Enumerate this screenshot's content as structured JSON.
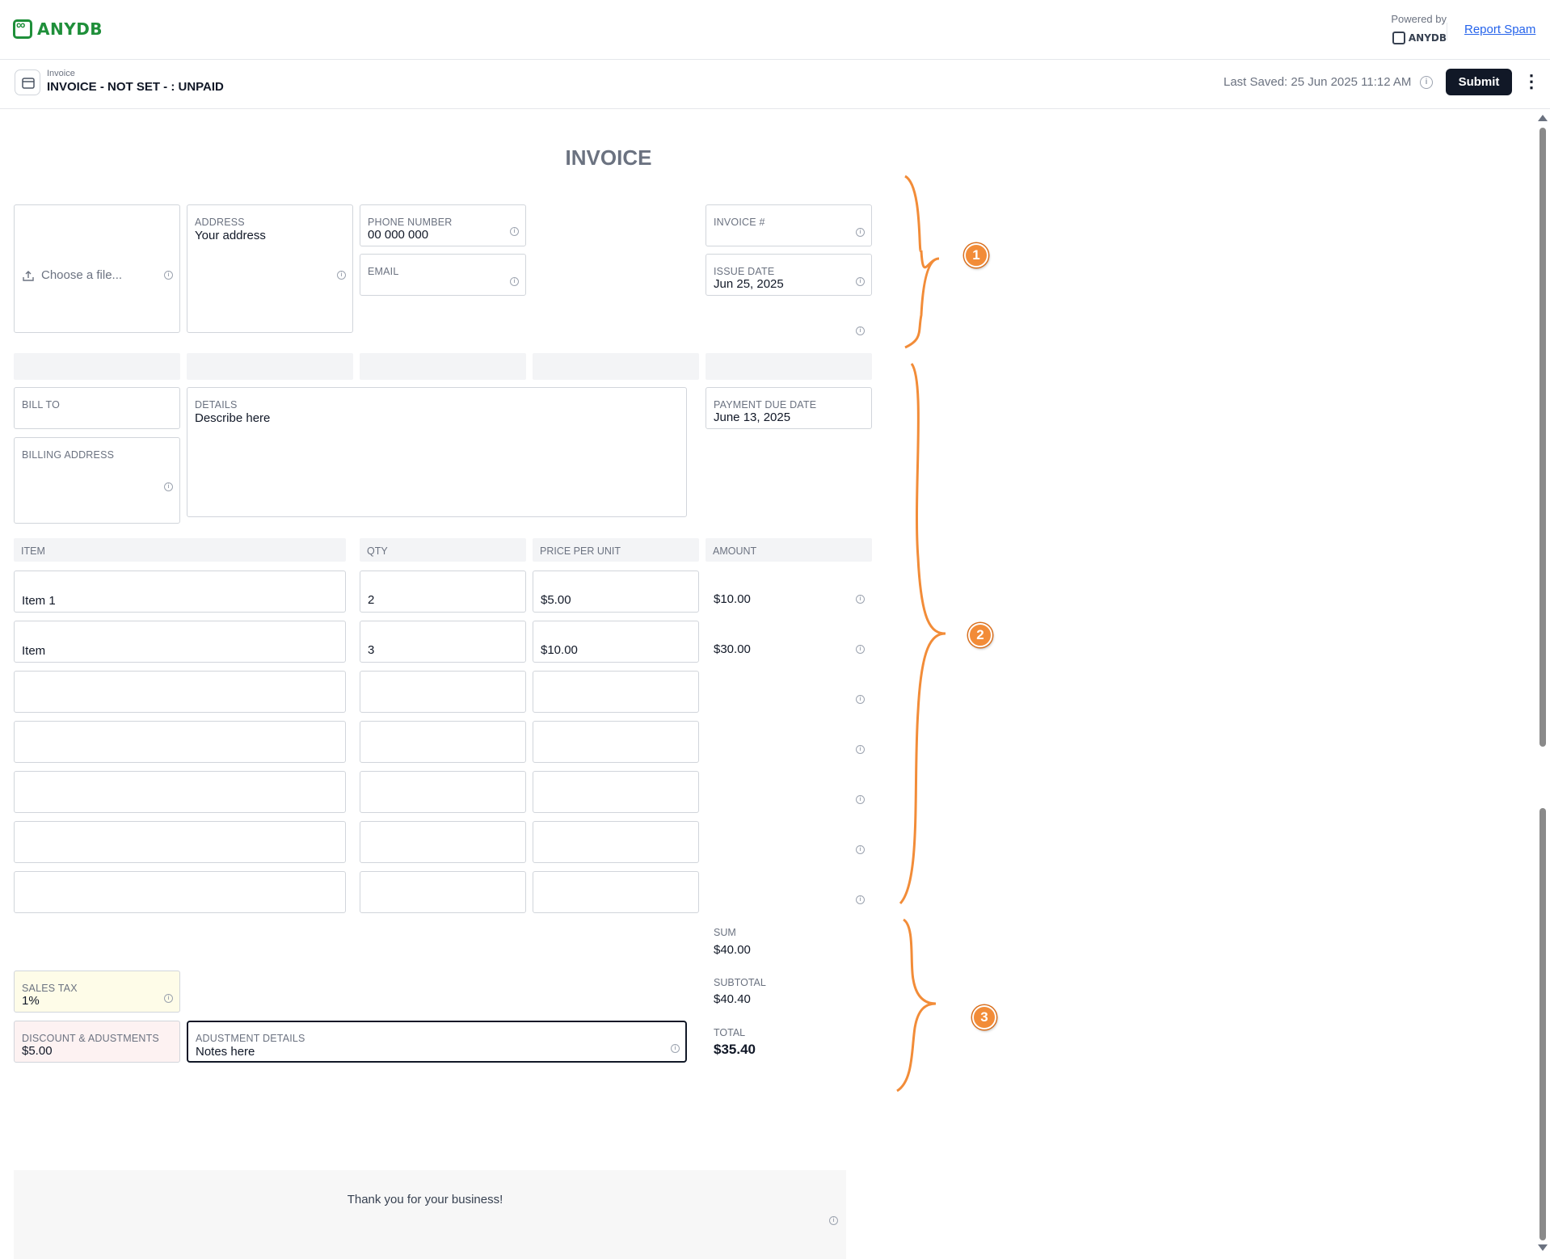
{
  "header": {
    "logo_text": "ANYDB",
    "powered_by": "Powered by",
    "powered_brand": "ANYDB",
    "report_spam": "Report Spam"
  },
  "record": {
    "type": "Invoice",
    "title": "INVOICE - NOT SET - : UNPAID",
    "last_saved": "Last Saved: 25 Jun 2025 11:12 AM",
    "submit_label": "Submit"
  },
  "form": {
    "title": "INVOICE",
    "logo_upload": "Choose a file...",
    "address": {
      "label": "ADDRESS",
      "value": "Your address"
    },
    "phone": {
      "label": "PHONE NUMBER",
      "value": "00 000 000"
    },
    "email": {
      "label": "EMAIL",
      "value": ""
    },
    "invoice_no": {
      "label": "INVOICE #",
      "value": ""
    },
    "issue_date": {
      "label": "ISSUE DATE",
      "value": "Jun 25, 2025"
    },
    "bill_to": {
      "label": "BILL TO",
      "value": ""
    },
    "billing_address": {
      "label": "BILLING ADDRESS",
      "value": ""
    },
    "details": {
      "label": "DETAILS",
      "value": "Describe here"
    },
    "payment_due": {
      "label": "PAYMENT DUE DATE",
      "value": "June 13, 2025"
    },
    "table": {
      "headers": [
        "ITEM",
        "QTY",
        "PRICE PER UNIT",
        "AMOUNT"
      ],
      "rows": [
        {
          "item": "Item 1",
          "qty": "2",
          "price": "$5.00",
          "amount": "$10.00"
        },
        {
          "item": "Item",
          "qty": "3",
          "price": "$10.00",
          "amount": "$30.00"
        },
        {
          "item": "",
          "qty": "",
          "price": "",
          "amount": ""
        },
        {
          "item": "",
          "qty": "",
          "price": "",
          "amount": ""
        },
        {
          "item": "",
          "qty": "",
          "price": "",
          "amount": ""
        },
        {
          "item": "",
          "qty": "",
          "price": "",
          "amount": ""
        },
        {
          "item": "",
          "qty": "",
          "price": "",
          "amount": ""
        }
      ]
    },
    "sum": {
      "label": "SUM",
      "value": "$40.00"
    },
    "sales_tax": {
      "label": "SALES TAX",
      "value": "1%"
    },
    "subtotal": {
      "label": "SUBTOTAL",
      "value": "$40.40"
    },
    "discount": {
      "label": "DISCOUNT & ADUSTMENTS",
      "value": "$5.00"
    },
    "adjustment_details": {
      "label": "ADUSTMENT DETAILS",
      "value": "Notes here"
    },
    "total": {
      "label": "TOTAL",
      "value": "$35.40"
    },
    "footer_note": "Thank you for your business!"
  },
  "annotations": [
    "1",
    "2",
    "3"
  ],
  "colors": {
    "brand_green": "#1f8f3a",
    "submit_bg": "#111827",
    "annotation_orange": "#f28c38",
    "sales_tax_bg": "#fefce8",
    "discount_bg": "#fdf2f2"
  }
}
